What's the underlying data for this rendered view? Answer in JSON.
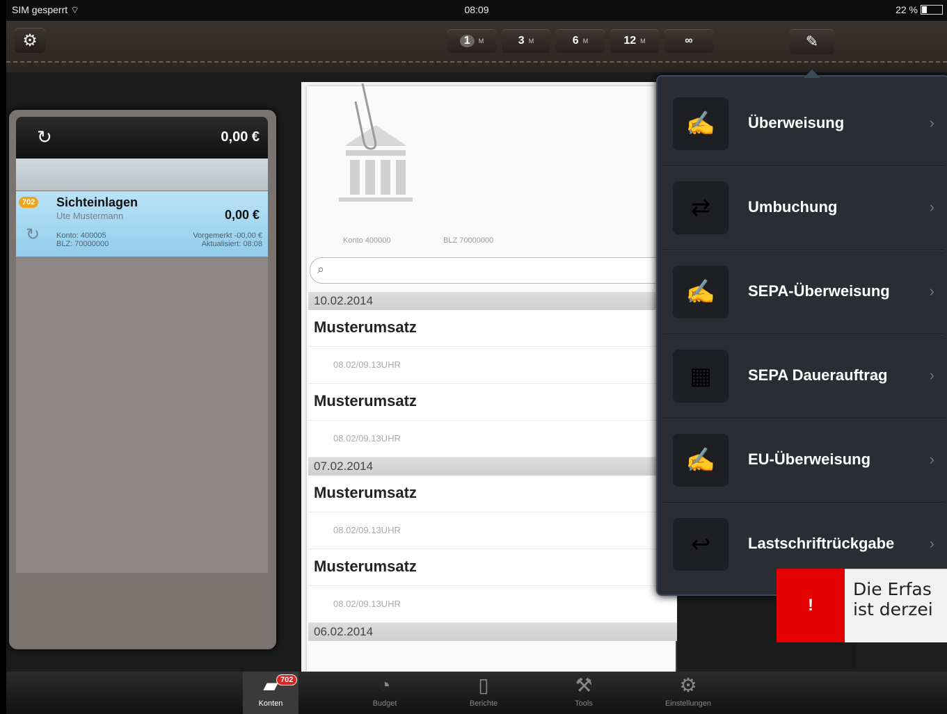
{
  "status_bar": {
    "carrier": "SIM gesperrt",
    "time": "08:09",
    "battery": "22 %",
    "battery_level": 0.22
  },
  "toolbar": {
    "periods": [
      {
        "num": "1",
        "unit": "M"
      },
      {
        "num": "3",
        "unit": "M"
      },
      {
        "num": "6",
        "unit": "M"
      },
      {
        "num": "12",
        "unit": "M"
      },
      {
        "num": "∞",
        "unit": ""
      }
    ],
    "active_period": "1"
  },
  "accounts_panel": {
    "total": "0,00 €",
    "account": {
      "badge": "702",
      "name": "Sichteinlagen",
      "owner": "Ute Mustermann",
      "amount": "0,00 €",
      "konto": "Konto: 400005",
      "blz": "BLZ: 70000000",
      "vorgemerkt": "Vorgemerkt -00,00 €",
      "aktualisiert": "Aktualisiert: 08:08"
    }
  },
  "statement": {
    "konto_label": "Konto 400000",
    "blz_label": "BLZ 70000000",
    "groups": [
      {
        "date": "10.02.2014",
        "items": [
          {
            "title": "Musterumsatz",
            "sub": "08.02/09.13UHR"
          },
          {
            "title": "Musterumsatz",
            "sub": "08.02/09.13UHR"
          }
        ]
      },
      {
        "date": "07.02.2014",
        "items": [
          {
            "title": "Musterumsatz",
            "sub": "08.02/09.13UHR"
          },
          {
            "title": "Musterumsatz",
            "sub": "08.02/09.13UHR"
          }
        ]
      },
      {
        "date": "06.02.2014",
        "items": []
      }
    ]
  },
  "popover": {
    "items": [
      {
        "label": "Überweisung",
        "icon": "pencil-form-icon"
      },
      {
        "label": "Umbuchung",
        "icon": "transfer-arrows-icon"
      },
      {
        "label": "SEPA-Überweisung",
        "icon": "sepa-transfer-icon"
      },
      {
        "label": "SEPA Dauerauftrag",
        "icon": "calendar-sepa-icon"
      },
      {
        "label": "EU-Überweisung",
        "icon": "eu-transfer-icon"
      },
      {
        "label": "Lastschriftrückgabe",
        "icon": "return-arrow-icon"
      }
    ]
  },
  "error": {
    "mark": "!",
    "line1": "Die Erfas",
    "line2": "ist derzei"
  },
  "tabbar": {
    "tabs": [
      "Konten",
      "Budget",
      "Berichte",
      "Tools",
      "Einstellungen"
    ],
    "konten_badge": "702"
  },
  "colors": {
    "accent_error": "#e40000",
    "account_highlight": "#93cdeb",
    "badge": "#f0a41e"
  }
}
